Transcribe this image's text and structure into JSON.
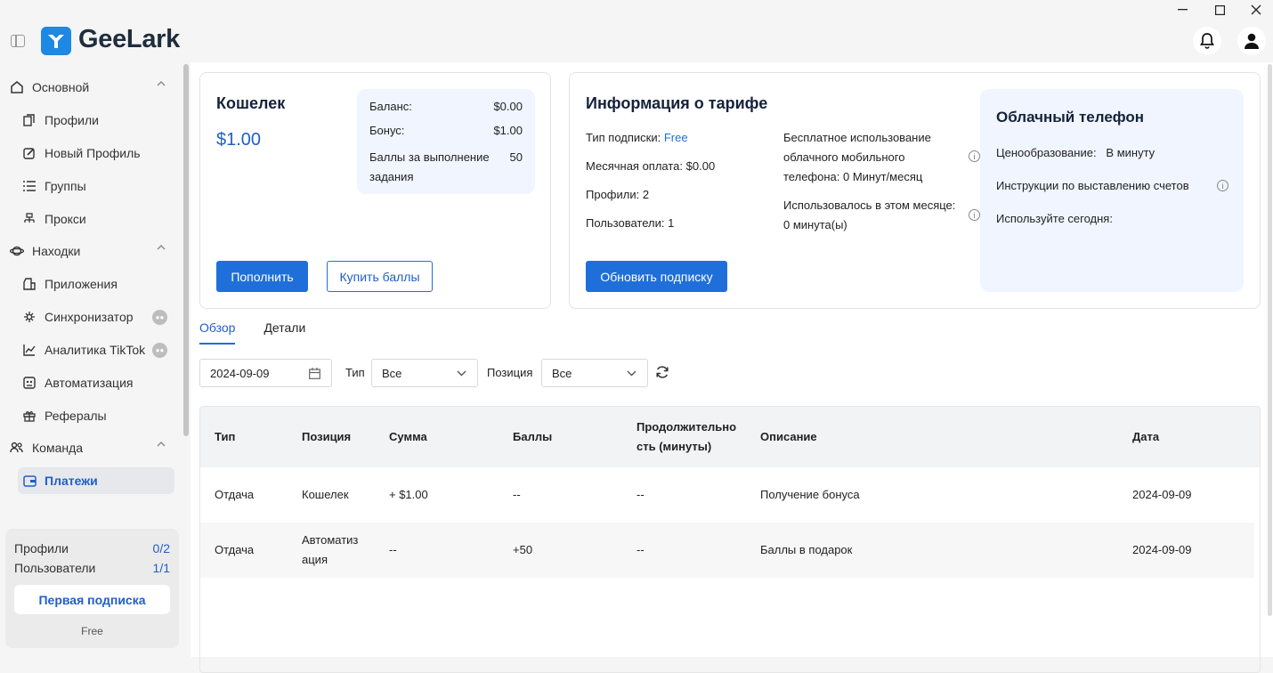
{
  "app": {
    "name": "GeeLark"
  },
  "sidebar": {
    "groups": [
      {
        "label": "Основной"
      },
      {
        "label": "Находки"
      },
      {
        "label": "Команда"
      }
    ],
    "items": [
      {
        "label": "Профили"
      },
      {
        "label": "Новый Профиль"
      },
      {
        "label": "Группы"
      },
      {
        "label": "Прокси"
      },
      {
        "label": "Приложения"
      },
      {
        "label": "Синхронизатор"
      },
      {
        "label": "Аналитика TikTok"
      },
      {
        "label": "Автоматизация"
      },
      {
        "label": "Рефералы"
      },
      {
        "label": "Платежи"
      }
    ],
    "subscription": {
      "profiles_label": "Профили",
      "profiles_value": "0/2",
      "users_label": "Пользователи",
      "users_value": "1/1",
      "button_label": "Первая подписка",
      "plan": "Free"
    }
  },
  "wallet": {
    "title": "Кошелек",
    "amount": "$1.00",
    "balance_label": "Баланс:",
    "balance_value": "$0.00",
    "bonus_label": "Бонус:",
    "bonus_value": "$1.00",
    "points_label": "Баллы за выполнение задания",
    "points_value": "50",
    "topup_button": "Пополнить",
    "buy_points_button": "Купить баллы"
  },
  "plan_info": {
    "title": "Информация о тарифе",
    "sub_type_label": "Тип подписки:",
    "sub_type_value": "Free",
    "monthly": "Месячная оплата: $0.00",
    "profiles": "Профили: 2",
    "users": "Пользователи: 1",
    "cloud_free": "Бесплатное использование облачного мобильного телефона: 0 Минут/месяц",
    "used_month": "Использовалось в этом месяце: 0 минута(ы)",
    "upgrade_button": "Обновить подписку"
  },
  "cloud_phone": {
    "title": "Облачный телефон",
    "pricing_label": "Ценообразование:",
    "pricing_value": "В минуту",
    "billing_instructions": "Инструкции по выставлению счетов",
    "use_today": "Используйте сегодня:"
  },
  "tabs": [
    {
      "label": "Обзор"
    },
    {
      "label": "Детали"
    }
  ],
  "filters": {
    "date": "2024-09-09",
    "type_label": "Тип",
    "type_value": "Все",
    "position_label": "Позиция",
    "position_value": "Все"
  },
  "table": {
    "headers": [
      "Тип",
      "Позиция",
      "Сумма",
      "Баллы",
      "Продолжительность (минуты)",
      "Описание",
      "Дата"
    ],
    "rows": [
      {
        "type": "Отдача",
        "position": "Кошелек",
        "amount": "+ $1.00",
        "points": "--",
        "duration": "--",
        "description": "Получение бонуса",
        "date": "2024-09-09"
      },
      {
        "type": "Отдача",
        "position": "Автоматизация",
        "amount": "--",
        "points": "+50",
        "duration": "--",
        "description": "Баллы в подарок",
        "date": "2024-09-09"
      }
    ]
  },
  "colors": {
    "accent": "#1f6fdb",
    "link": "#1f5fc8",
    "panel_bg": "#f0f5ff"
  }
}
